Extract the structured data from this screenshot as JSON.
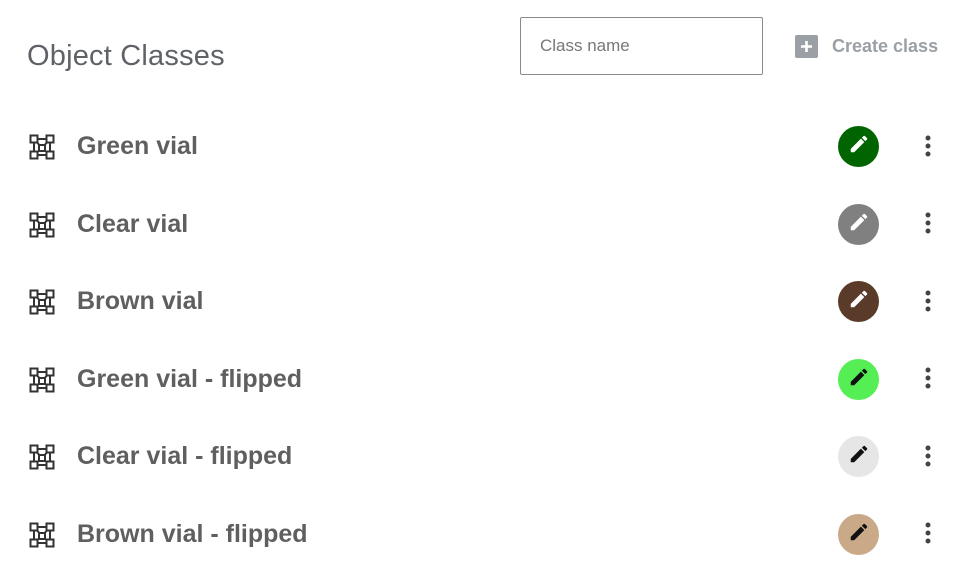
{
  "header": {
    "title": "Object Classes",
    "input_placeholder": "Class name",
    "create_label": "Create class",
    "create_icon": "plus-box-icon"
  },
  "classes": [
    {
      "label": "Green vial",
      "color": "#006400",
      "pencil": "#ffffff"
    },
    {
      "label": "Clear vial",
      "color": "#808080",
      "pencil": "#ffffff"
    },
    {
      "label": "Brown vial",
      "color": "#5a3a28",
      "pencil": "#ffffff"
    },
    {
      "label": "Green vial - flipped",
      "color": "#55ee55",
      "pencil": "#111111"
    },
    {
      "label": "Clear vial - flipped",
      "color": "#e6e6e6",
      "pencil": "#111111"
    },
    {
      "label": "Brown vial - flipped",
      "color": "#caa988",
      "pencil": "#111111"
    }
  ],
  "icons": {
    "row": "bounding-polygon-icon",
    "color": "pencil-icon",
    "menu": "more-vertical-icon"
  }
}
